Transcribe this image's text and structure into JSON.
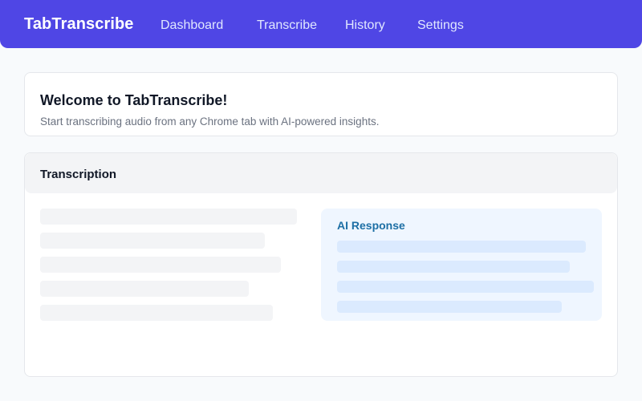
{
  "header": {
    "brand": "TabTranscribe",
    "nav": [
      "Dashboard",
      "Transcribe",
      "History",
      "Settings"
    ]
  },
  "welcome": {
    "title": "Welcome to TabTranscribe!",
    "subtitle": "Start transcribing audio from any Chrome tab with AI-powered insights."
  },
  "transcription": {
    "title": "Transcription",
    "ai_response_title": "AI Response"
  },
  "colors": {
    "accent": "#4f46e5",
    "ai_panel_bg": "#eff6ff",
    "ai_title": "#1d6fa5"
  }
}
